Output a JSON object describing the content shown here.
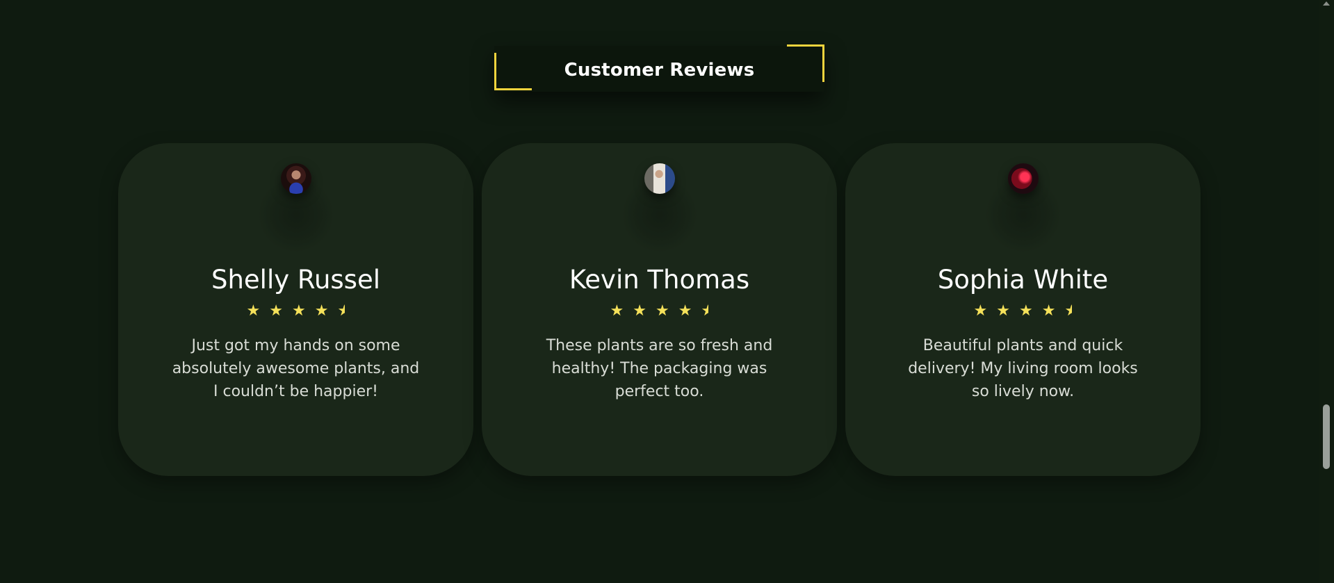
{
  "section": {
    "title": "Customer Reviews"
  },
  "reviews": [
    {
      "name": "Shelly Russel",
      "rating": 4.5,
      "text": "Just got my hands on some absolutely awesome plants, and I couldn’t be happier!",
      "avatar_icon": "user-avatar"
    },
    {
      "name": "Kevin Thomas",
      "rating": 4.5,
      "text": "These plants are so fresh and healthy! The packaging was perfect too.",
      "avatar_icon": "user-avatar"
    },
    {
      "name": "Sophia White",
      "rating": 4.5,
      "text": "Beautiful plants and quick delivery! My living room looks so lively now.",
      "avatar_icon": "user-avatar"
    }
  ],
  "stars": {
    "full": "★",
    "half": "★"
  },
  "colors": {
    "background": "#0f1b10",
    "card": "#1a2719",
    "accent": "#f2d43d",
    "star": "#f5e15a",
    "text": "#ffffff"
  },
  "scroll": {
    "position_fraction": 0.77
  }
}
